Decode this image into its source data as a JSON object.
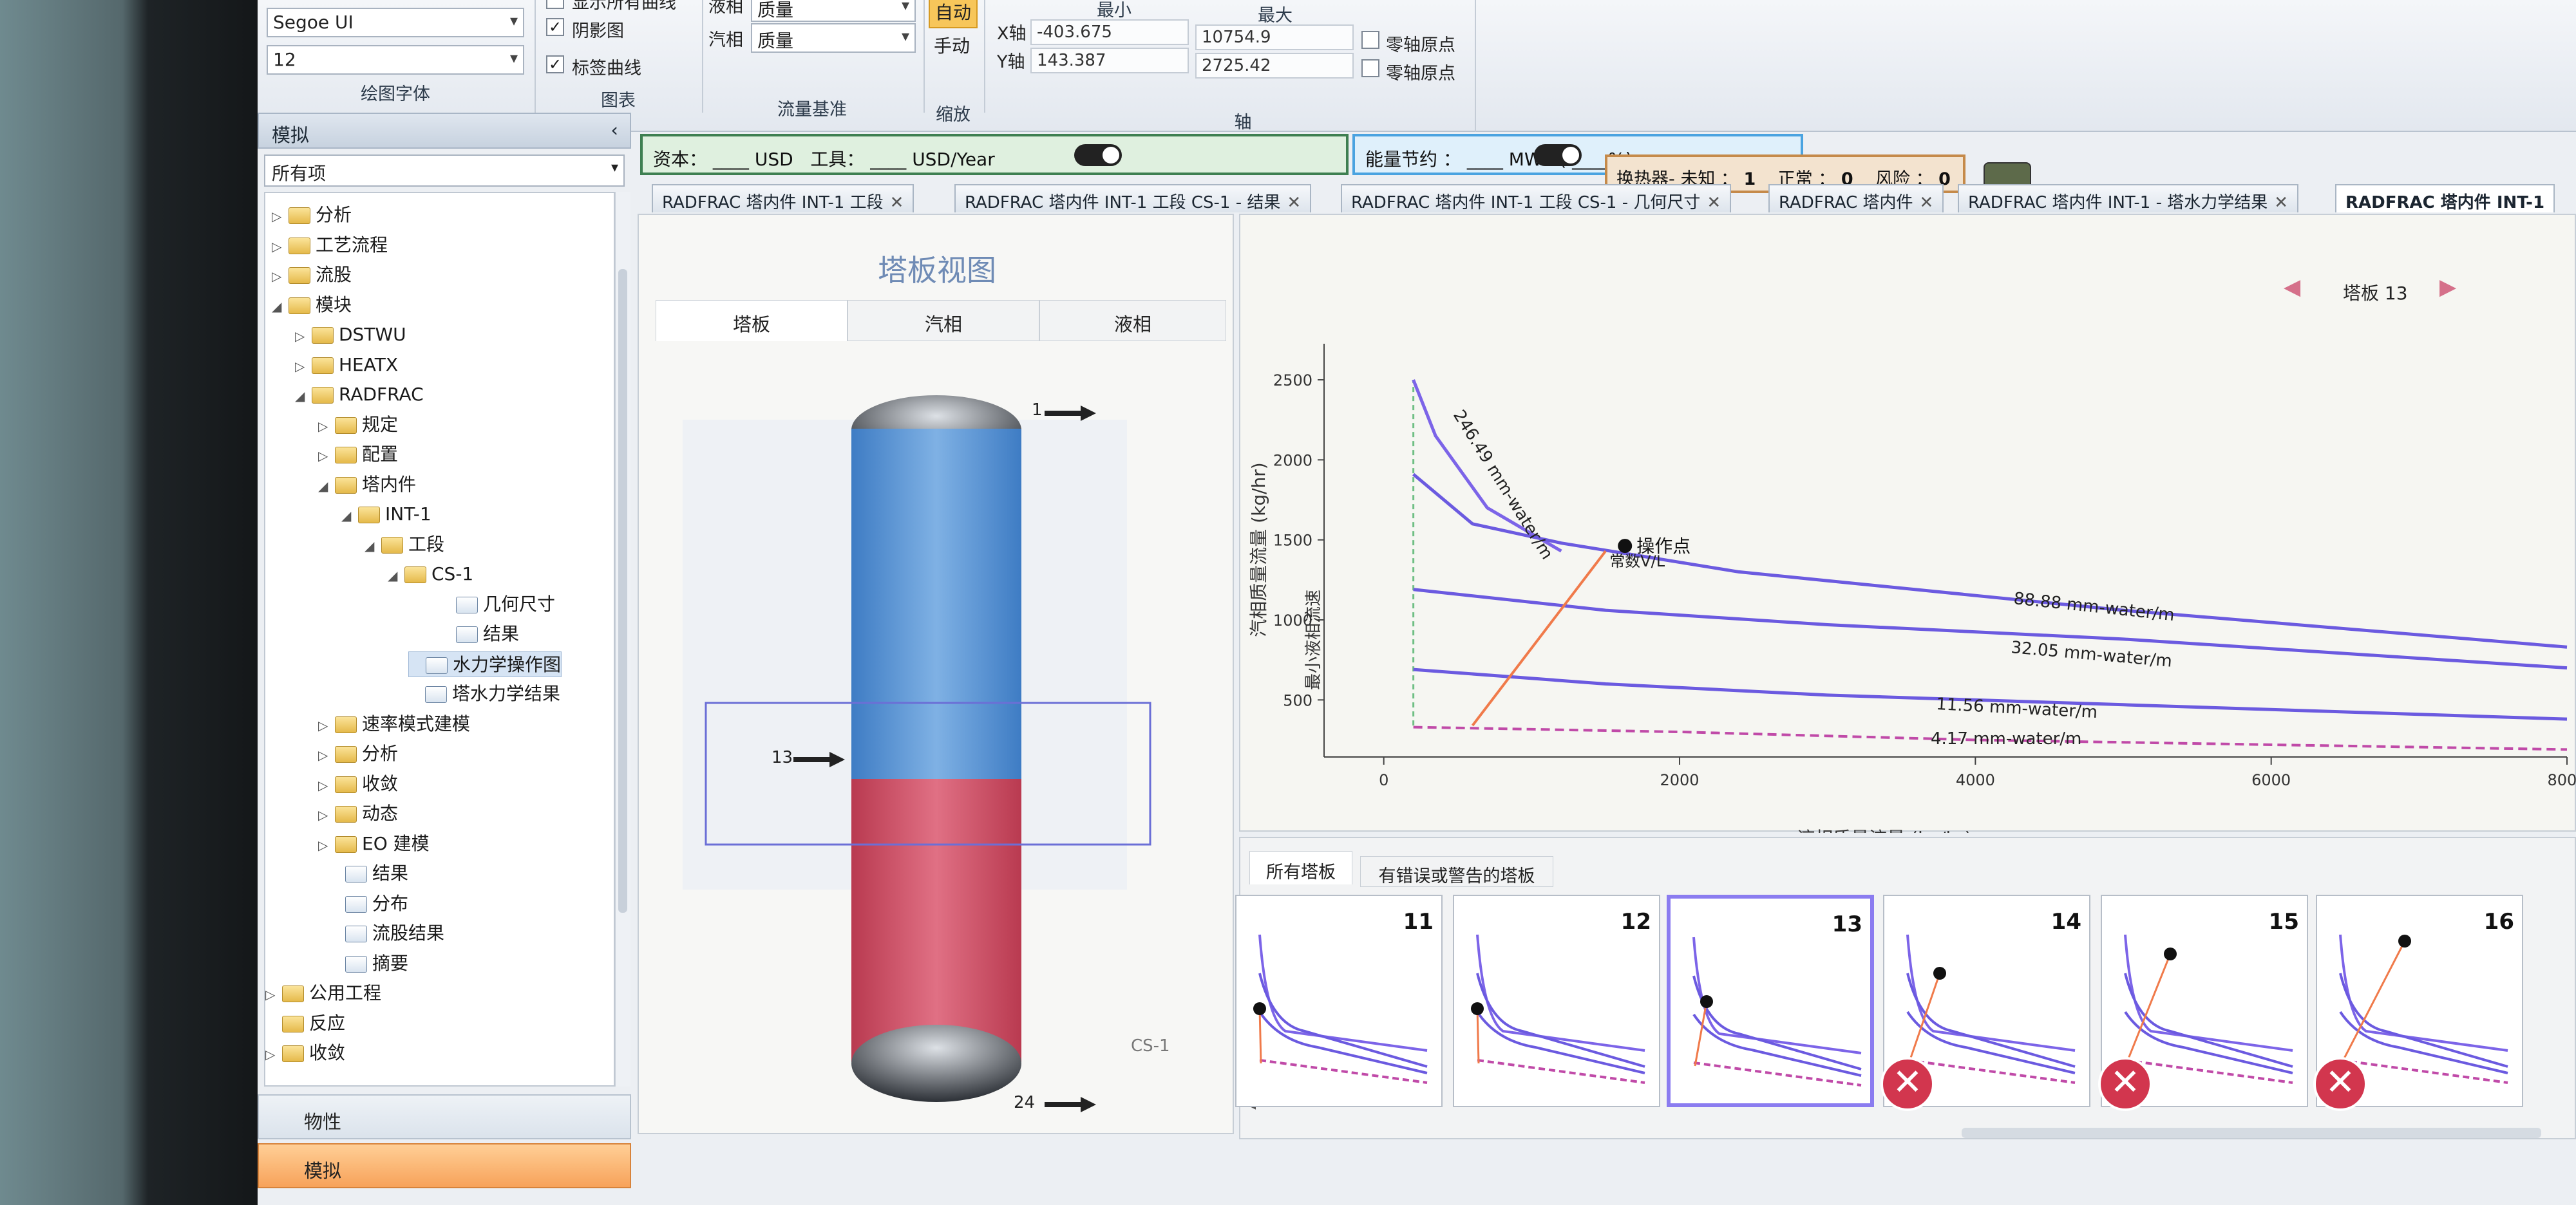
{
  "ribbon": {
    "font_name": "Segoe UI",
    "font_size": "12",
    "group_font": "绘图字体",
    "cb_partial_top": "显示所有曲线",
    "cb_shadow": "阴影图",
    "cb_label_curves": "标签曲线",
    "group_chart": "图表",
    "liquid_label": "液相",
    "liquid_value": "质量",
    "vapor_label": "汽相",
    "vapor_value": "质量",
    "group_flow": "流量基准",
    "zoom_auto": "自动",
    "zoom_manual": "手动",
    "group_zoom": "缩放",
    "col_min": "最小",
    "col_max": "最大",
    "x_axis_label": "X轴",
    "x_min": "-403.675",
    "x_max": "10754.9",
    "y_axis_label": "Y轴",
    "y_min": "143.387",
    "y_max": "2725.42",
    "zero_origin_1": "零轴原点",
    "zero_origin_2": "零轴原点",
    "group_axis": "轴"
  },
  "nav": {
    "title": "模拟",
    "collapse": "‹",
    "filter": "所有项",
    "tree": [
      {
        "label": "分析",
        "exp": "▷",
        "icon": "folder"
      },
      {
        "label": "工艺流程",
        "exp": "▷",
        "icon": "folder"
      },
      {
        "label": "流股",
        "exp": "▷",
        "icon": "folder"
      },
      {
        "label": "模块",
        "exp": "◢",
        "icon": "folder"
      },
      {
        "label": "DSTWU",
        "exp": "▷",
        "icon": "folder"
      },
      {
        "label": "HEATX",
        "exp": "▷",
        "icon": "folder"
      },
      {
        "label": "RADFRAC",
        "exp": "◢",
        "icon": "folder"
      },
      {
        "label": "规定",
        "exp": "▷",
        "icon": "folder"
      },
      {
        "label": "配置",
        "exp": "▷",
        "icon": "folder"
      },
      {
        "label": "塔内件",
        "exp": "◢",
        "icon": "folder"
      },
      {
        "label": "INT-1",
        "exp": "◢",
        "icon": "folder"
      },
      {
        "label": "工段",
        "exp": "◢",
        "icon": "folder"
      },
      {
        "label": "CS-1",
        "exp": "◢",
        "icon": "folder"
      },
      {
        "label": "几何尺寸",
        "exp": "",
        "icon": "doc"
      },
      {
        "label": "结果",
        "exp": "",
        "icon": "doc"
      },
      {
        "label": "水力学操作图",
        "exp": "",
        "icon": "doc"
      },
      {
        "label": "塔水力学结果",
        "exp": "",
        "icon": "doc"
      },
      {
        "label": "速率模式建模",
        "exp": "▷",
        "icon": "folder"
      },
      {
        "label": "分析",
        "exp": "▷",
        "icon": "folder"
      },
      {
        "label": "收敛",
        "exp": "▷",
        "icon": "folder"
      },
      {
        "label": "动态",
        "exp": "▷",
        "icon": "folder"
      },
      {
        "label": "EO 建模",
        "exp": "▷",
        "icon": "folder"
      },
      {
        "label": "结果",
        "exp": "",
        "icon": "doc"
      },
      {
        "label": "分布",
        "exp": "",
        "icon": "doc"
      },
      {
        "label": "流股结果",
        "exp": "",
        "icon": "doc"
      },
      {
        "label": "摘要",
        "exp": "",
        "icon": "doc"
      },
      {
        "label": "公用工程",
        "exp": "▷",
        "icon": "folder"
      },
      {
        "label": "反应",
        "exp": "",
        "icon": "folder"
      },
      {
        "label": "收敛",
        "exp": "▷",
        "icon": "folder"
      }
    ],
    "props": "物性",
    "sim": "模拟"
  },
  "status": {
    "capital": "资本：",
    "capital_unit": "USD",
    "utility": "工具：",
    "utility_unit": "USD/Year",
    "blank": "____",
    "energy": "能量节约 ：",
    "energy_unit": "MW",
    "energy_pct": "( ____%)",
    "hx": "换热器-  未知 ：",
    "hx_unknown": "1",
    "hx_normal_l": "正常 ：",
    "hx_normal": "0",
    "hx_risk_l": "风险 ：",
    "hx_risk": "0"
  },
  "tabs": [
    "RADFRAC 塔内件 INT-1 工段",
    "RADFRAC 塔内件 INT-1 工段 CS-1 - 结果",
    "RADFRAC 塔内件 INT-1 工段 CS-1 - 几何尺寸",
    "RADFRAC 塔内件",
    "RADFRAC 塔内件 INT-1 - 塔水力学结果",
    "RADFRAC 塔内件 INT-1"
  ],
  "tray_view": {
    "title": "塔板视图",
    "tabs": [
      "塔板",
      "汽相",
      "液相"
    ],
    "stage_top": "1",
    "stage_mid": "13",
    "stage_bottom": "24",
    "section": "CS-1"
  },
  "plot_nav": {
    "prev": "◀",
    "label": "塔板 13",
    "next": "▶"
  },
  "chart_data": {
    "type": "line",
    "xlabel": "液相质量流量 (kg/hr)",
    "ylabel": "汽相质量流量 (kg/hr)",
    "xlim": [
      -403.675,
      8000
    ],
    "ylim": [
      143.387,
      2725.42
    ],
    "xticks": [
      0,
      2000,
      4000,
      6000,
      8000
    ],
    "yticks": [
      500,
      1000,
      1500,
      2000,
      2500
    ],
    "min_liquid_label": "最小液相流速",
    "op_point_label": "操作点",
    "const_vl_label": "常数V/L",
    "operating_point": {
      "x": 1500,
      "y": 1430
    },
    "series": [
      {
        "name": "246.49 mm-water/m",
        "label": "246.49 mm-water/m",
        "color": "#7c64e8",
        "points": [
          [
            200,
            2500
          ],
          [
            350,
            2150
          ],
          [
            700,
            1700
          ],
          [
            1200,
            1430
          ]
        ]
      },
      {
        "name": "88.88 mm-water/m",
        "label": "88.88 mm-water/m",
        "color": "#6b5ae0",
        "points": [
          [
            200,
            1910
          ],
          [
            600,
            1600
          ],
          [
            1200,
            1480
          ],
          [
            2400,
            1300
          ],
          [
            5000,
            1060
          ],
          [
            8000,
            830
          ]
        ]
      },
      {
        "name": "32.05 mm-water/m",
        "label": "32.05 mm-water/m",
        "color": "#6b5ae0",
        "points": [
          [
            200,
            1190
          ],
          [
            1500,
            1060
          ],
          [
            3000,
            970
          ],
          [
            5000,
            880
          ],
          [
            8000,
            700
          ]
        ]
      },
      {
        "name": "11.56 mm-water/m",
        "label": "11.56 mm-water/m",
        "color": "#6b5ae0",
        "points": [
          [
            200,
            690
          ],
          [
            1500,
            600
          ],
          [
            3000,
            530
          ],
          [
            5000,
            470
          ],
          [
            8000,
            380
          ]
        ]
      },
      {
        "name": "4.17 mm-water/m",
        "label": "4.17 mm-water/m",
        "color": "#c04aa8",
        "points": [
          [
            200,
            330
          ],
          [
            2000,
            300
          ],
          [
            4000,
            250
          ],
          [
            8000,
            190
          ]
        ]
      }
    ],
    "lines": {
      "constant_vl": {
        "color": "#f07a4a",
        "points": [
          [
            600,
            340
          ],
          [
            1500,
            1430
          ]
        ]
      },
      "min_liquid": {
        "color": "#6fbf84",
        "points": [
          [
            200,
            340
          ],
          [
            200,
            2500
          ]
        ]
      }
    }
  },
  "trays": {
    "tabs": [
      "所有塔板",
      "有错误或警告的塔板"
    ],
    "items": [
      {
        "n": "11",
        "err": false,
        "dot": true
      },
      {
        "n": "12",
        "err": false,
        "dot": true
      },
      {
        "n": "13",
        "err": false,
        "dot": true
      },
      {
        "n": "14",
        "err": true,
        "dot": true
      },
      {
        "n": "15",
        "err": true,
        "dot": true
      },
      {
        "n": "16",
        "err": true,
        "dot": true
      }
    ]
  },
  "colors": {
    "accent": "#8b7cf0",
    "vapor": "#5b8fc7",
    "liquid": "#c9465c",
    "error": "#d2364e"
  }
}
